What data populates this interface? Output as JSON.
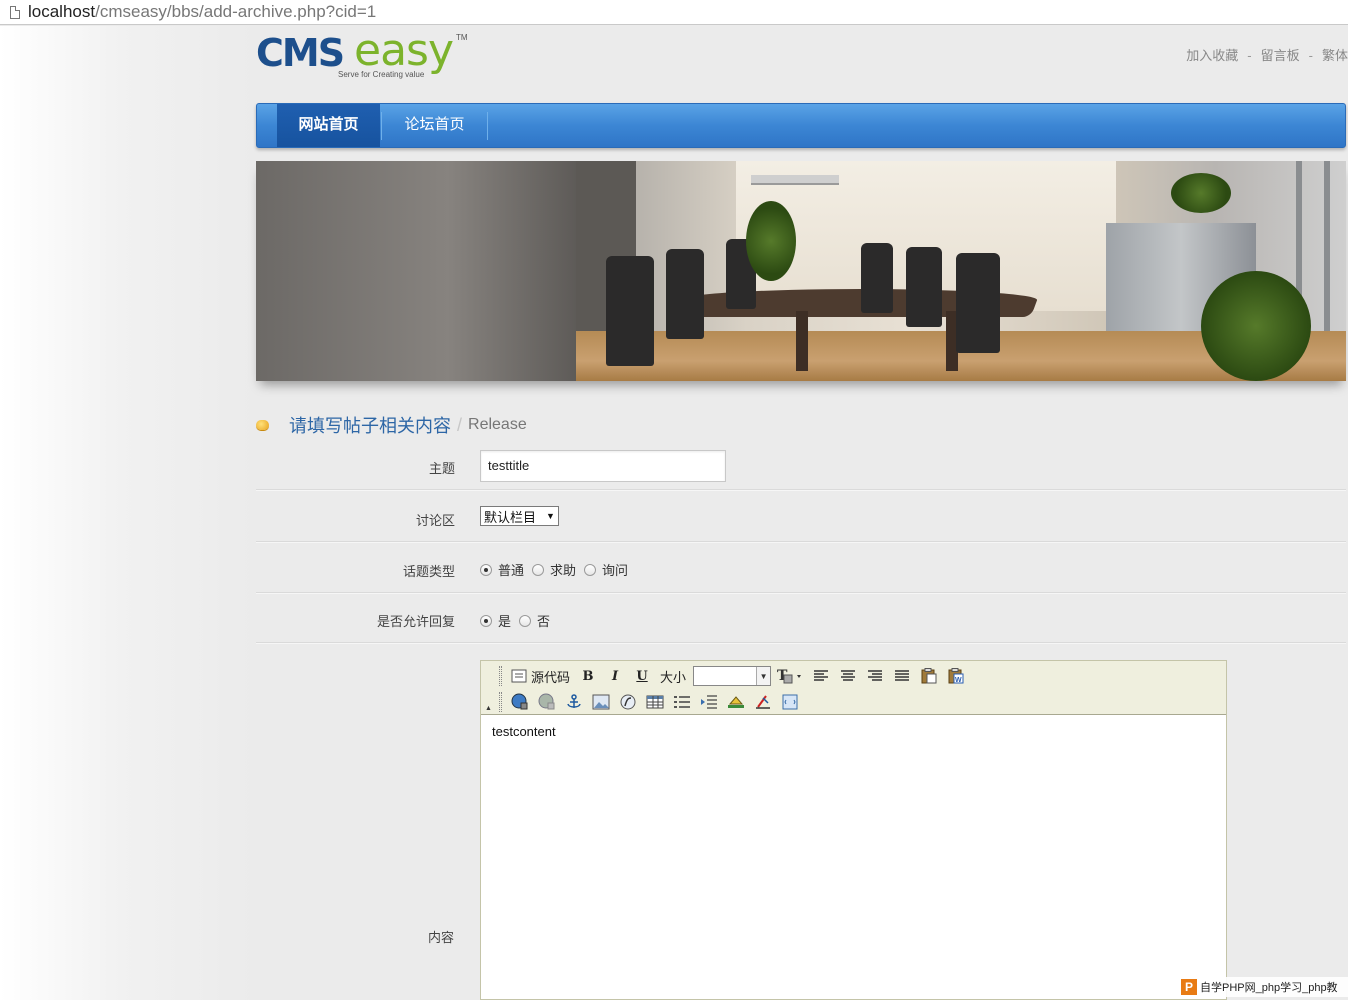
{
  "browser": {
    "url_host": "localhost",
    "url_path": "/cmseasy/bbs/add-archive.php?cid=1"
  },
  "logo": {
    "cms": "CMS",
    "easy": "easy",
    "tm": "TM",
    "tagline": "Serve for Creating value"
  },
  "toplinks": {
    "bookmark": "加入收藏",
    "guestbook": "留言板",
    "traditional": "繁体",
    "separator": "-"
  },
  "nav": {
    "items": [
      {
        "label": "网站首页",
        "active": true
      },
      {
        "label": "论坛首页",
        "active": false
      }
    ]
  },
  "section": {
    "title_zh": "请填写帖子相关内容",
    "slash": "/",
    "title_en": "Release"
  },
  "form": {
    "subject": {
      "label": "主题",
      "value": "testtitle"
    },
    "forum": {
      "label": "讨论区",
      "selected": "默认栏目",
      "caret": "▼"
    },
    "topic_type": {
      "label": "话题类型",
      "options": [
        {
          "label": "普通",
          "checked": true
        },
        {
          "label": "求助",
          "checked": false
        },
        {
          "label": "询问",
          "checked": false
        }
      ]
    },
    "allow_reply": {
      "label": "是否允许回复",
      "options": [
        {
          "label": "是",
          "checked": true
        },
        {
          "label": "否",
          "checked": false
        }
      ]
    },
    "content": {
      "label": "内容",
      "value": "testcontent",
      "toolbar": {
        "source": "源代码",
        "bold": "B",
        "italic": "I",
        "underline": "U",
        "size_label": "大小",
        "size_value": ""
      }
    }
  },
  "watermark": {
    "logo": "P",
    "text": "自学PHP网_php学习_php教"
  },
  "colors": {
    "nav_blue": "#3c86d4",
    "title_blue": "#2d66a6",
    "editor_toolbar": "#efefde"
  }
}
